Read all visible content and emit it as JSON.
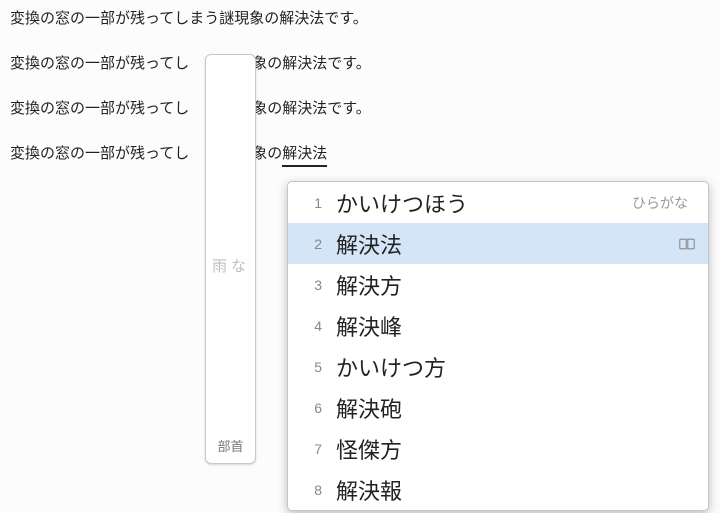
{
  "lines": {
    "l1": "変換の窓の一部が残ってしまう謎現象の解決法です。",
    "l2a": "変換の窓の一部が残ってし",
    "l2b": "う謎現象の解決法です。",
    "l3a": "変換の窓の一部が残ってし",
    "l3b": "う謎現象の解決法です。",
    "l4a": "変換の窓の一部が残ってし",
    "l4b": "う謎現象の",
    "l4c": "解決法"
  },
  "ghost": {
    "hint": "雨な",
    "footer": "部首"
  },
  "candidates": [
    {
      "idx": "1",
      "word": "かいけつほう",
      "hint": "ひらがな",
      "selected": false,
      "dict": false
    },
    {
      "idx": "2",
      "word": "解決法",
      "hint": "",
      "selected": true,
      "dict": true
    },
    {
      "idx": "3",
      "word": "解決方",
      "hint": "",
      "selected": false,
      "dict": false
    },
    {
      "idx": "4",
      "word": "解決峰",
      "hint": "",
      "selected": false,
      "dict": false
    },
    {
      "idx": "5",
      "word": "かいけつ方",
      "hint": "",
      "selected": false,
      "dict": false
    },
    {
      "idx": "6",
      "word": "解決砲",
      "hint": "",
      "selected": false,
      "dict": false
    },
    {
      "idx": "7",
      "word": "怪傑方",
      "hint": "",
      "selected": false,
      "dict": false
    },
    {
      "idx": "8",
      "word": "解決報",
      "hint": "",
      "selected": false,
      "dict": false
    }
  ]
}
